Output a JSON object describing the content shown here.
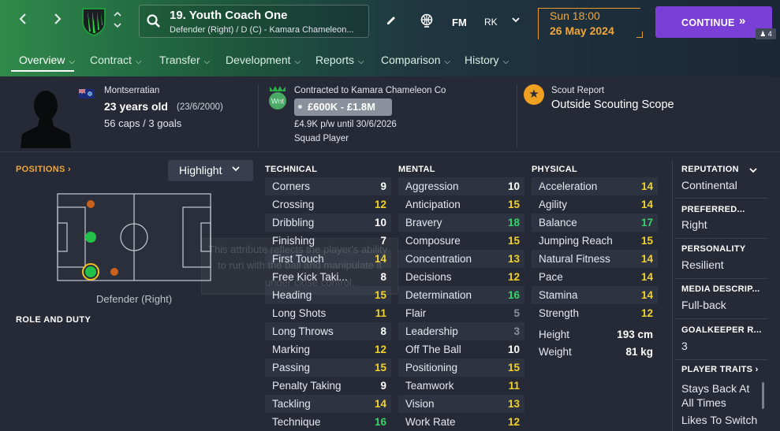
{
  "header": {
    "player_name": "19. Youth Coach One",
    "player_sub": "Defender (Right) / D (C) - Kamara Chameleon...",
    "fm_label": "FM",
    "rk_label": "RK",
    "date_day": "Sun 18:00",
    "date_full": "26 May 2024",
    "continue_label": "CONTINUE",
    "continue_arrow": "»",
    "badge": "4"
  },
  "tabs": [
    {
      "label": "Overview"
    },
    {
      "label": "Contract"
    },
    {
      "label": "Transfer"
    },
    {
      "label": "Development"
    },
    {
      "label": "Reports"
    },
    {
      "label": "Comparison"
    },
    {
      "label": "History"
    }
  ],
  "info": {
    "nationality": "Montserratian",
    "age": "23 years old",
    "dob": "(23/6/2000)",
    "caps": "56 caps / 3 goals",
    "contracted": "Contracted to Kamara Chameleon Co",
    "club_badge": "Wnt",
    "value": "£600K - £1.8M",
    "wage": "£4.9K p/w until 30/6/2026",
    "squad_status": "Squad Player",
    "scout_title": "Scout Report",
    "scout_value": "Outside Scouting Scope"
  },
  "left": {
    "positions_label": "POSITIONS",
    "highlight_label": "Highlight",
    "position_caption": "Defender (Right)",
    "role_duty_label": "ROLE AND DUTY",
    "tooltip_line1": "This attribute reflects the player's ability",
    "tooltip_line2": "to run with the ball and manipulate it",
    "tooltip_line3": "under close control."
  },
  "attributes": {
    "technical": {
      "title": "TECHNICAL",
      "rows": [
        {
          "name": "Corners",
          "value": "9"
        },
        {
          "name": "Crossing",
          "value": "12"
        },
        {
          "name": "Dribbling",
          "value": "10"
        },
        {
          "name": "Finishing",
          "value": "7"
        },
        {
          "name": "First Touch",
          "value": "14"
        },
        {
          "name": "Free Kick Taki...",
          "value": "8"
        },
        {
          "name": "Heading",
          "value": "15"
        },
        {
          "name": "Long Shots",
          "value": "11"
        },
        {
          "name": "Long Throws",
          "value": "8"
        },
        {
          "name": "Marking",
          "value": "12"
        },
        {
          "name": "Passing",
          "value": "15"
        },
        {
          "name": "Penalty Taking",
          "value": "9"
        },
        {
          "name": "Tackling",
          "value": "14"
        },
        {
          "name": "Technique",
          "value": "16"
        }
      ]
    },
    "mental": {
      "title": "MENTAL",
      "rows": [
        {
          "name": "Aggression",
          "value": "10"
        },
        {
          "name": "Anticipation",
          "value": "15"
        },
        {
          "name": "Bravery",
          "value": "18"
        },
        {
          "name": "Composure",
          "value": "15"
        },
        {
          "name": "Concentration",
          "value": "13"
        },
        {
          "name": "Decisions",
          "value": "12"
        },
        {
          "name": "Determination",
          "value": "16"
        },
        {
          "name": "Flair",
          "value": "5"
        },
        {
          "name": "Leadership",
          "value": "3"
        },
        {
          "name": "Off The Ball",
          "value": "10"
        },
        {
          "name": "Positioning",
          "value": "15"
        },
        {
          "name": "Teamwork",
          "value": "11"
        },
        {
          "name": "Vision",
          "value": "13"
        },
        {
          "name": "Work Rate",
          "value": "12"
        }
      ]
    },
    "physical": {
      "title": "PHYSICAL",
      "rows": [
        {
          "name": "Acceleration",
          "value": "14"
        },
        {
          "name": "Agility",
          "value": "14"
        },
        {
          "name": "Balance",
          "value": "17"
        },
        {
          "name": "Jumping Reach",
          "value": "15"
        },
        {
          "name": "Natural Fitness",
          "value": "14"
        },
        {
          "name": "Pace",
          "value": "14"
        },
        {
          "name": "Stamina",
          "value": "14"
        },
        {
          "name": "Strength",
          "value": "12"
        }
      ],
      "height_label": "Height",
      "height_value": "193 cm",
      "weight_label": "Weight",
      "weight_value": "81 kg"
    }
  },
  "right": {
    "reputation_label": "REPUTATION",
    "reputation_value": "Continental",
    "foot_label": "PREFERRED...",
    "foot_value": "Right",
    "personality_label": "PERSONALITY",
    "personality_value": "Resilient",
    "media_label": "MEDIA DESCRIP...",
    "media_value": "Full-back",
    "gk_label": "GOALKEEPER R...",
    "gk_value": "3",
    "traits_label": "PLAYER TRAITS",
    "trait1_a": "Stays Back At",
    "trait1_b": "All Times",
    "trait2": "Likes To Switch"
  },
  "colors": {
    "accent_orange": "#f0a63a",
    "continue_purple": "#7a3fd6",
    "white_value": "#ffffff",
    "yellow_value": "#f0d22a",
    "green_value": "#35d36a",
    "grey_value": "#8a8f9a"
  },
  "icons": [
    "back-arrow-icon",
    "forward-arrow-icon",
    "club-crest-icon",
    "search-icon",
    "edit-pencil-icon",
    "globe-icon",
    "chevron-down-icon",
    "star-icon",
    "player-silhouette-icon",
    "flag-icon"
  ]
}
